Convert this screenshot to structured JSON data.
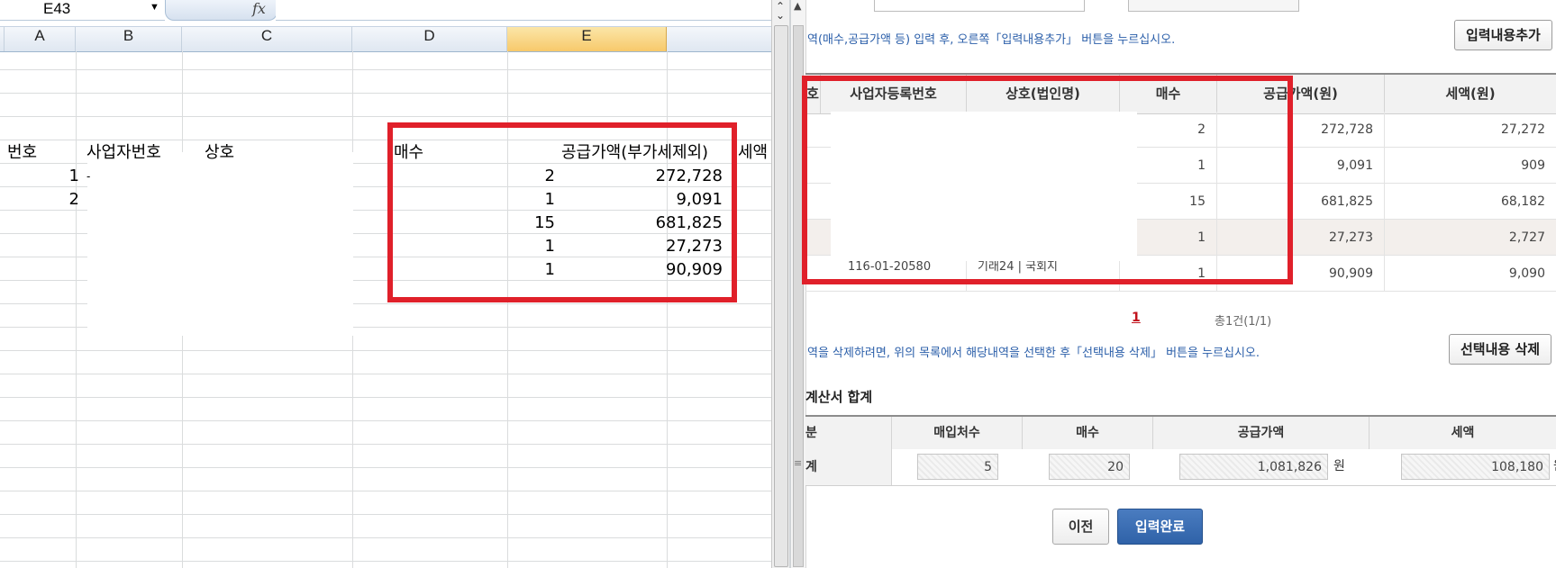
{
  "spreadsheet": {
    "name_box": "E43",
    "fx_label": "fx",
    "columns": [
      "A",
      "B",
      "C",
      "D",
      "E"
    ],
    "header_row": {
      "a": "번호",
      "b": "사업자번호",
      "c": "상호",
      "d": "매수",
      "e": "공급가액(부가세제외)",
      "f": "세액"
    },
    "rows": [
      {
        "no": "1",
        "mark": "-",
        "count": "2",
        "supply": "272,728"
      },
      {
        "no": "2",
        "mark": "",
        "count": "1",
        "supply": "9,091"
      },
      {
        "no": "",
        "mark": "",
        "count": "15",
        "supply": "681,825"
      },
      {
        "no": "",
        "mark": "",
        "count": "1",
        "supply": "27,273"
      },
      {
        "no": "",
        "mark": "",
        "count": "1",
        "supply": "90,909"
      }
    ]
  },
  "web": {
    "instruction_top": "역(매수,공급가액 등) 입력 후, 오른쪽「입력내용추가」 버튼을 누르십시오.",
    "add_button": "입력내용추가",
    "table_headers": {
      "no": "호",
      "reg_no": "사업자등록번호",
      "name": "상호(법인명)",
      "count": "매수",
      "supply": "공급가액(원)",
      "tax": "세액(원)"
    },
    "rows": [
      {
        "count": "2",
        "supply": "272,728",
        "tax": "27,272"
      },
      {
        "count": "1",
        "supply": "9,091",
        "tax": "909"
      },
      {
        "count": "15",
        "supply": "681,825",
        "tax": "68,182"
      },
      {
        "count": "1",
        "supply": "27,273",
        "tax": "2,727"
      },
      {
        "count": "1",
        "supply": "90,909",
        "tax": "9,090",
        "partial_reg": "116-01-20580",
        "partial_name": "기래24 | 국회지"
      }
    ],
    "pagination": {
      "page": "1",
      "total": "총1건(1/1)"
    },
    "instruction_delete": "역을 삭제하려면, 위의 목록에서 해당내역을 선택한 후「선택내용 삭제」 버튼을 누르십시오.",
    "delete_button": "선택내용 삭제",
    "summary_title": "계산서 합계",
    "summary_headers": {
      "kind": "분",
      "buyers": "매입처수",
      "count": "매수",
      "supply": "공급가액",
      "tax": "세액"
    },
    "summary_row": {
      "kind": "계",
      "buyers": "5",
      "count": "20",
      "supply": "1,081,826",
      "tax": "108,180",
      "unit": "원"
    },
    "prev_button": "이전",
    "complete_button": "입력완료"
  },
  "colors": {
    "highlight_red": "#e0202a",
    "link_blue": "#2a5ea9",
    "primary_button": "#2f62a8"
  }
}
